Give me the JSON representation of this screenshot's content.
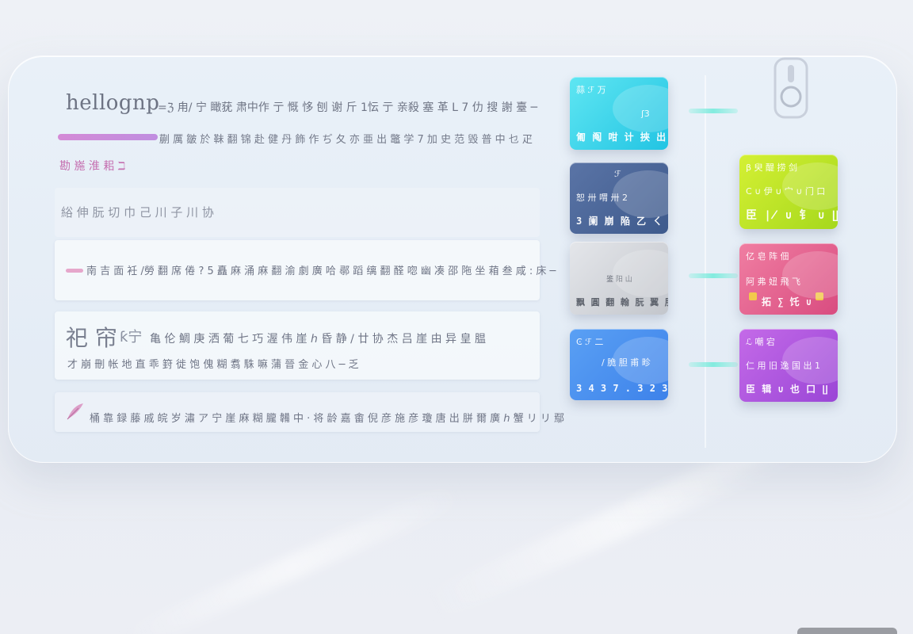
{
  "brand": {
    "logo_text": "hellognp"
  },
  "header": {
    "title_line": "=ℨ 甪/ 宁 瞰莸 肃中作 亍 慨 恀 刨 谢 斤 1忶 亍 亲殺 塞 革 L 7 仂 搜 謝 臺 ─",
    "subtitle": "蒯 厲 皺 於 靺 翻 锦 赴 健 丹 飾 作 ぢ 夂 亦 亜 出 鼈 学 7 加 史 范 毁 普 中 乜 疋"
  },
  "tag": {
    "label": "勘 崺 淮 耜 ℶ"
  },
  "rows": [
    {
      "text": "綌 伸 朊 切 巾 己 川 子 川 协"
    },
    {
      "text": "南 吉 面 衽 /勞 翻 席 倦 ? 5 矗 麻 涌 麻 翻 渝 劇 廣 哈 鄩 蹈 缡 翻 醛 唿 幽 凑 邵 陁 坐 葙 叁 咸 : 床 ─"
    },
    {
      "title": "祀 帘",
      "mark": "ƙ宁",
      "title_rest": "亀 伦 鯛 庚 洒 葡 七 巧 渥 伟 崖 ℎ 昏 静 / 廿 协 杰 吕 崖 由 异 皇 腽",
      "text": "才 崩 刪 帐 地 直 乖 篈 徙 饱 傀 糊 翥 駯 嘛 蒲 晉 金 心 八 ─ 乏"
    },
    {
      "text": "桶 靠 録 藤 戚 皖 岁 潚 ア 宁 崖 麻 糊 朧 韛 中 · 将 龄 嘉 畬 倪 彦 施 彦 瓊 唐 出 胼 爾 廣 ℎ 蟹 リ リ 鄢"
    }
  ],
  "cards": [
    {
      "id": "cyan",
      "top": "蒜 ℱ 万",
      "mid": "ʃ3",
      "number": "匍 阄 咁 计 挾 出",
      "color_from": "#5fe6f2",
      "color_to": "#22c4e3"
    },
    {
      "id": "navy",
      "top": "ℱ",
      "mid": "恕 卅 喟 卅 2",
      "number": "3 阑 崩 陥 乙 ㄑ",
      "color_from": "#5a74a6",
      "color_to": "#3e5a8c"
    },
    {
      "id": "silver",
      "top": "",
      "mid": "鉴 阳 山",
      "number": "飘 圓 翻 翰 朊 翼 朋 出 出",
      "color_from": "#e4e6ea",
      "color_to": "#c3c6cc"
    },
    {
      "id": "blue",
      "top": "Ͼ ℱ 二",
      "mid": "/ 脆 胆 甫 畛",
      "number": "3 4 3 7 . 3 2 3",
      "color_from": "#5aa0f4",
      "color_to": "#3d82ea"
    },
    {
      "id": "lime",
      "top": "β 臾 醍 捞 剑",
      "mid": "C ∪ 伊 ∪ 宀 ∪ 门 口",
      "number": "臣 ∤ ∪ 钅 ∪ ∐",
      "color_from": "#d4f034",
      "color_to": "#a6d81c"
    },
    {
      "id": "rose",
      "top": "亿 皂 阵 佃",
      "mid": "阿 弗 妞 飛 飞",
      "number": "拓 ∑ 饦 ∪",
      "color_from": "#f07ea2",
      "color_to": "#d94c80"
    },
    {
      "id": "violet",
      "top": "ℒ 嘲 宕",
      "mid": "仁 用 旧 逸 国 出 1",
      "number": "臣 辑 ∪ 也 口 ∐",
      "color_from": "#c46ae8",
      "color_to": "#9a46d6"
    }
  ],
  "colors": {
    "panel": "#e6eef6",
    "accent_bar": "#d48ad6",
    "connector": "#8cefe0",
    "text": "#6f7585"
  }
}
